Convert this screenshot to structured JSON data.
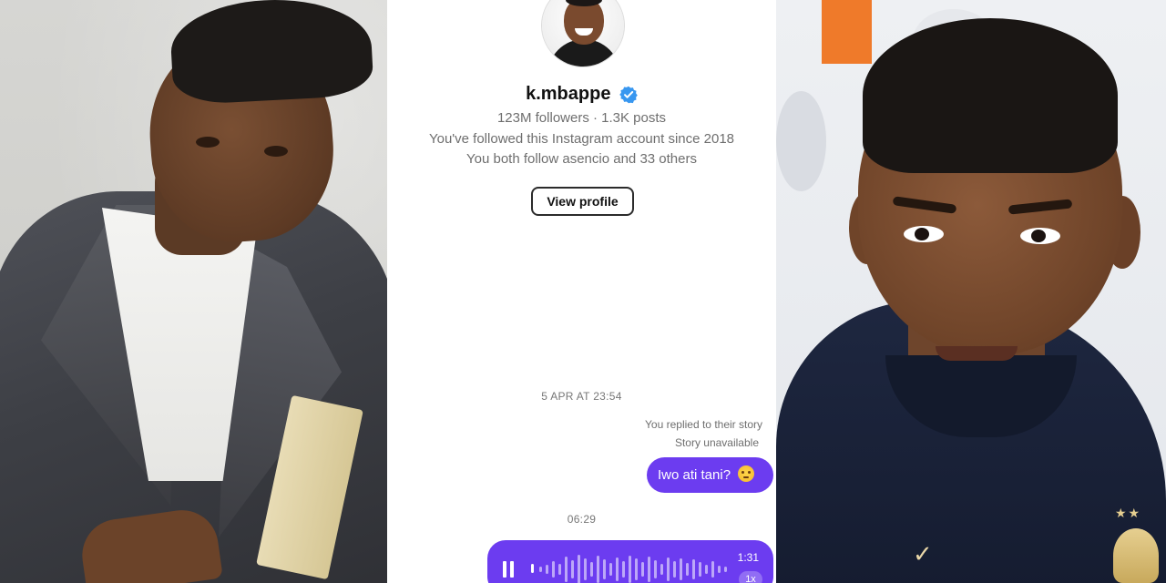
{
  "profile": {
    "username": "k.mbappe",
    "verified_icon": "verified-badge-icon",
    "stats": "123M followers · 1.3K posts",
    "followed_since": "You've followed this Instagram account since 2018",
    "mutual": "You both follow asencio and 33 others",
    "view_profile_label": "View profile"
  },
  "thread": {
    "timestamp_1": "5 APR AT 23:54",
    "replied_note": "You replied to their story",
    "story_status": "Story unavailable",
    "message_text": "Iwo ati tani?",
    "message_emoji_icon": "flushed-face-emoji-icon",
    "timestamp_2": "06:29",
    "voice": {
      "duration": "1:31",
      "speed": "1x",
      "control_icon": "pause-icon"
    }
  },
  "colors": {
    "bubble": "#6c3cf0",
    "verified": "#3897f0"
  }
}
